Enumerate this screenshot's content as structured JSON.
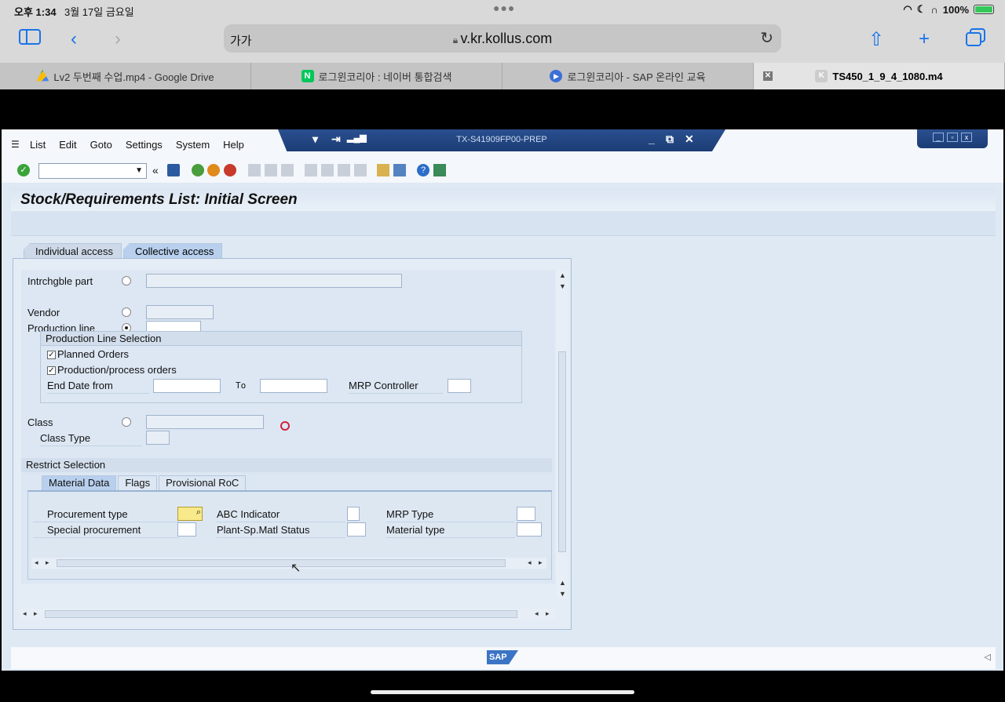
{
  "ipad": {
    "time": "오후 1:34",
    "date": "3월 17일 금요일",
    "battery": "100%"
  },
  "safari": {
    "text_size": "가가",
    "url": "v.kr.kollus.com",
    "tabs": [
      {
        "title": "Lv2 두번째 수업.mp4 - Google Drive"
      },
      {
        "title": "로그윈코리아 : 네이버 통합검색"
      },
      {
        "title": "로그윈코리아 - SAP 온라인 교육"
      },
      {
        "title": "TS450_1_9_4_1080.m4"
      }
    ]
  },
  "sap": {
    "menu": [
      "List",
      "Edit",
      "Goto",
      "Settings",
      "System",
      "Help"
    ],
    "system_id": "TX-S41909FP00-PREP",
    "screen_title": "Stock/Requirements List: Initial Screen",
    "main_tabs": [
      "Individual access",
      "Collective access"
    ],
    "fields": {
      "intrchgble_part": "Intrchgble part",
      "vendor": "Vendor",
      "production_line": "Production line",
      "pls_title": "Production Line Selection",
      "planned_orders": "Planned Orders",
      "prod_orders": "Production/process orders",
      "end_date_from": "End Date from",
      "to": "To",
      "mrp_controller": "MRP Controller",
      "class": "Class",
      "class_type": "Class Type"
    },
    "restrict": {
      "title": "Restrict Selection",
      "tabs": [
        "Material Data",
        "Flags",
        "Provisional RoC"
      ],
      "procurement_type": "Procurement type",
      "special_procurement": "Special procurement",
      "abc_indicator": "ABC Indicator",
      "plant_sp_status": "Plant-Sp.Matl Status",
      "mrp_type": "MRP Type",
      "material_type": "Material type"
    },
    "logo": "SAP"
  }
}
